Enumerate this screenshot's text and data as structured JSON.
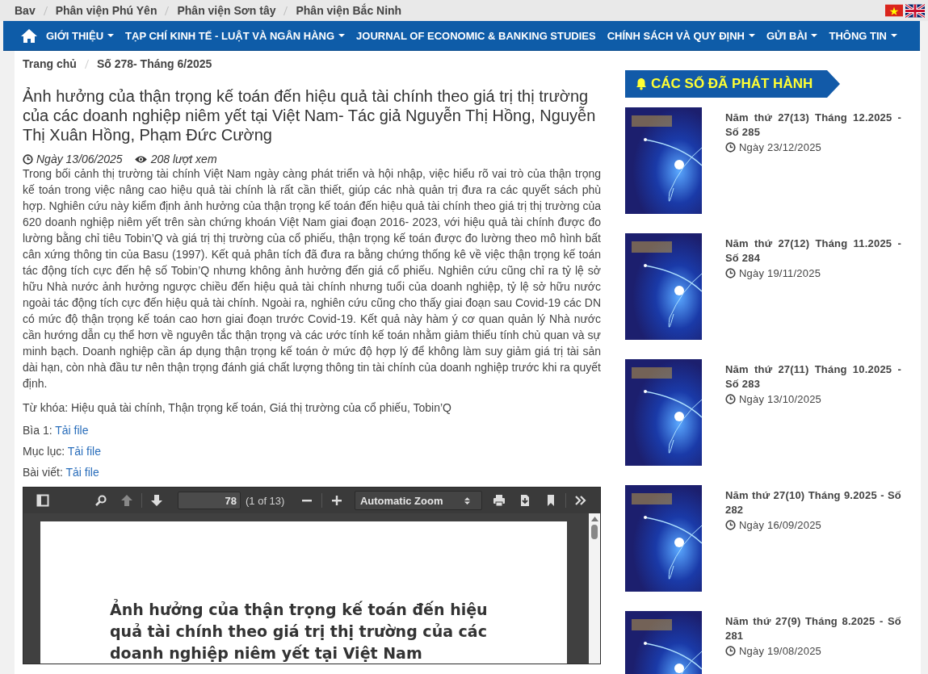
{
  "top_links": [
    "Bav",
    "Phân viện Phú Yên",
    "Phân viện Sơn tây",
    "Phân viện Bắc Ninh"
  ],
  "nav": {
    "items": [
      {
        "label": "GIỚI THIỆU",
        "dropdown": true
      },
      {
        "label": "TẠP CHÍ KINH TẾ - LUẬT VÀ NGÂN HÀNG",
        "dropdown": true
      },
      {
        "label": "JOURNAL OF ECONOMIC & BANKING STUDIES",
        "dropdown": false
      },
      {
        "label": "CHÍNH SÁCH VÀ QUY ĐỊNH",
        "dropdown": true
      },
      {
        "label": "GỬI BÀI",
        "dropdown": true
      },
      {
        "label": "THÔNG TIN",
        "dropdown": true
      }
    ]
  },
  "breadcrumb": [
    "Trang chủ",
    "Số 278- Tháng 6/2025"
  ],
  "article": {
    "title": "Ảnh hưởng của thận trọng kế toán đến hiệu quả tài chính theo giá trị thị trường của các doanh nghiệp niêm yết tại Việt Nam- Tác giả Nguyễn Thị Hồng, Nguyễn Thị Xuân Hồng, Phạm Đức Cường",
    "date": "Ngày 13/06/2025",
    "views": "208 lượt xem",
    "abstract": "Trong bối cảnh thị trường tài chính Việt Nam ngày càng phát triển và hội nhập, việc hiểu rõ vai trò của thận trọng kế toán trong việc nâng cao hiệu quả tài chính là rất cần thiết, giúp các nhà quản trị đưa ra các quyết sách phù hợp. Nghiên cứu này kiểm định ảnh hưởng của thận trọng kế toán đến hiệu quả tài chính theo giá trị thị trường của 620 doanh nghiệp niêm yết trên sàn chứng khoán Việt Nam giai đoạn 2016- 2023, với hiệu quả tài chính được đo lường bằng chỉ tiêu Tobin’Q và giá trị thị trường của cổ phiếu, thận trọng kế toán được đo lường theo mô hình bất cân xứng thông tin của Basu (1997). Kết quả phân tích đã đưa ra bằng chứng thống kê về việc thận trọng kế toán tác động tích cực đến hệ số Tobin’Q nhưng không ảnh hưởng đến giá cổ phiếu. Nghiên cứu cũng chỉ ra tỷ lệ sở hữu Nhà nước ảnh hưởng ngược chiều đến hiệu quả tài chính nhưng tuổi của doanh nghiệp, tỷ lệ sở hữu nước ngoài tác động tích cực đến hiệu quả tài chính. Ngoài ra, nghiên cứu cũng cho thấy giai đoạn sau Covid-19 các DN có mức độ thận trọng kế toán cao hơn giai đoạn trước Covid-19. Kết quả này hàm ý cơ quan quản lý Nhà nước cần hướng dẫn cụ thể hơn về nguyên tắc thận trọng và các ước tính kế toán nhằm giảm thiểu tính chủ quan và sự minh bạch. Doanh nghiệp cần áp dụng thận trọng kế toán ở mức độ hợp lý để không làm suy giảm giá trị tài sản dài hạn, còn nhà đầu tư nên thận trọng đánh giá chất lượng thông tin tài chính của doanh nghiệp trước khi ra quyết định.",
    "keywords": "Từ khóa: Hiệu quả tài chính, Thận trọng kế toán, Giá thị trường của cổ phiếu, Tobin’Q",
    "downloads": [
      {
        "label": "Bìa 1:",
        "link": "Tải file"
      },
      {
        "label": "Mục lục:",
        "link": "Tải file"
      },
      {
        "label": "Bài viết:",
        "link": "Tải file"
      }
    ],
    "pdf_viewer": {
      "page_number": "78",
      "page_count": "(1 of 13)",
      "zoom": "Automatic Zoom",
      "page_title": "Ảnh hưởng của thận trọng kế toán đến hiệu quả tài chính theo giá trị thị trường của các doanh nghiệp niêm yết tại Việt Nam"
    }
  },
  "sidebar": {
    "heading": "CÁC SỐ ĐÃ PHÁT HÀNH",
    "issues": [
      {
        "title": "Năm thứ 27(13) Tháng 12.2025 - Số 285",
        "date": "Ngày 23/12/2025"
      },
      {
        "title": "Năm thứ 27(12) Tháng 11.2025 - Số 284",
        "date": "Ngày 19/11/2025"
      },
      {
        "title": "Năm thứ 27(11) Tháng 10.2025 - Số 283",
        "date": "Ngày 13/10/2025"
      },
      {
        "title": "Năm thứ 27(10) Tháng 9.2025 - Số 282",
        "date": "Ngày 16/09/2025"
      },
      {
        "title": "Năm thứ 27(9) Tháng 8.2025 - Số 281",
        "date": "Ngày 19/08/2025"
      }
    ]
  }
}
